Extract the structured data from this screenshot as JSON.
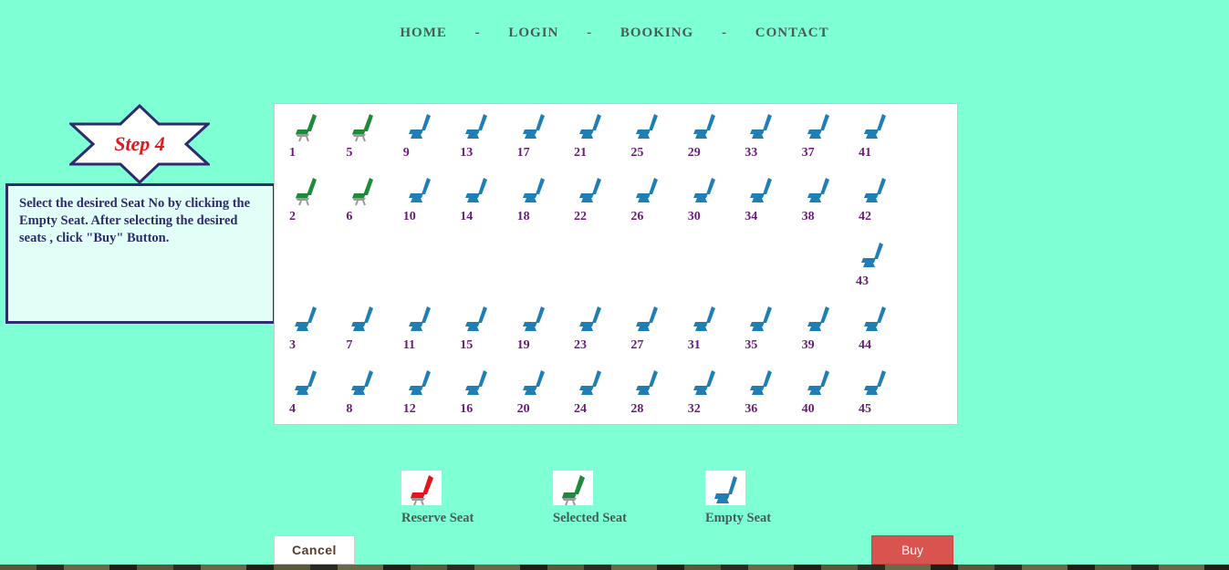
{
  "nav": {
    "home": "HOME",
    "login": "LOGIN",
    "booking": "BOOKING",
    "contact": "CONTACT",
    "separator": "-"
  },
  "step": {
    "label": "Step 4",
    "instructions": "Select the desired Seat No by clicking the Empty Seat. After selecting the desired seats , click \"Buy\" Button."
  },
  "colors": {
    "background": "#7fffd4",
    "empty_seat": "#1f7fb4",
    "selected_seat": "#1e8a3a",
    "reserved_seat": "#e3161c",
    "seat_number": "#6a1b7a",
    "buy_button": "#d9534f"
  },
  "seat_rows": [
    {
      "row": 1,
      "seats": [
        {
          "no": "1",
          "state": "selected"
        },
        {
          "no": "5",
          "state": "selected"
        },
        {
          "no": "9",
          "state": "empty"
        },
        {
          "no": "13",
          "state": "empty"
        },
        {
          "no": "17",
          "state": "empty"
        },
        {
          "no": "21",
          "state": "empty"
        },
        {
          "no": "25",
          "state": "empty"
        },
        {
          "no": "29",
          "state": "empty"
        },
        {
          "no": "33",
          "state": "empty"
        },
        {
          "no": "37",
          "state": "empty"
        },
        {
          "no": "41",
          "state": "empty"
        }
      ]
    },
    {
      "row": 2,
      "seats": [
        {
          "no": "2",
          "state": "selected"
        },
        {
          "no": "6",
          "state": "selected"
        },
        {
          "no": "10",
          "state": "empty"
        },
        {
          "no": "14",
          "state": "empty"
        },
        {
          "no": "18",
          "state": "empty"
        },
        {
          "no": "22",
          "state": "empty"
        },
        {
          "no": "26",
          "state": "empty"
        },
        {
          "no": "30",
          "state": "empty"
        },
        {
          "no": "34",
          "state": "empty"
        },
        {
          "no": "38",
          "state": "empty"
        },
        {
          "no": "42",
          "state": "empty"
        }
      ]
    },
    {
      "row": 3,
      "seats": [
        {
          "no": "43",
          "state": "empty",
          "column": 11
        }
      ]
    },
    {
      "row": 4,
      "seats": [
        {
          "no": "3",
          "state": "empty"
        },
        {
          "no": "7",
          "state": "empty"
        },
        {
          "no": "11",
          "state": "empty"
        },
        {
          "no": "15",
          "state": "empty"
        },
        {
          "no": "19",
          "state": "empty"
        },
        {
          "no": "23",
          "state": "empty"
        },
        {
          "no": "27",
          "state": "empty"
        },
        {
          "no": "31",
          "state": "empty"
        },
        {
          "no": "35",
          "state": "empty"
        },
        {
          "no": "39",
          "state": "empty"
        },
        {
          "no": "44",
          "state": "empty"
        }
      ]
    },
    {
      "row": 5,
      "seats": [
        {
          "no": "4",
          "state": "empty"
        },
        {
          "no": "8",
          "state": "empty"
        },
        {
          "no": "12",
          "state": "empty"
        },
        {
          "no": "16",
          "state": "empty"
        },
        {
          "no": "20",
          "state": "empty"
        },
        {
          "no": "24",
          "state": "empty"
        },
        {
          "no": "28",
          "state": "empty"
        },
        {
          "no": "32",
          "state": "empty"
        },
        {
          "no": "36",
          "state": "empty"
        },
        {
          "no": "40",
          "state": "empty"
        },
        {
          "no": "45",
          "state": "empty"
        }
      ]
    }
  ],
  "legend": {
    "reserve": "Reserve Seat",
    "selected": "Selected Seat",
    "empty": "Empty Seat"
  },
  "buttons": {
    "cancel": "Cancel",
    "buy": "Buy"
  }
}
